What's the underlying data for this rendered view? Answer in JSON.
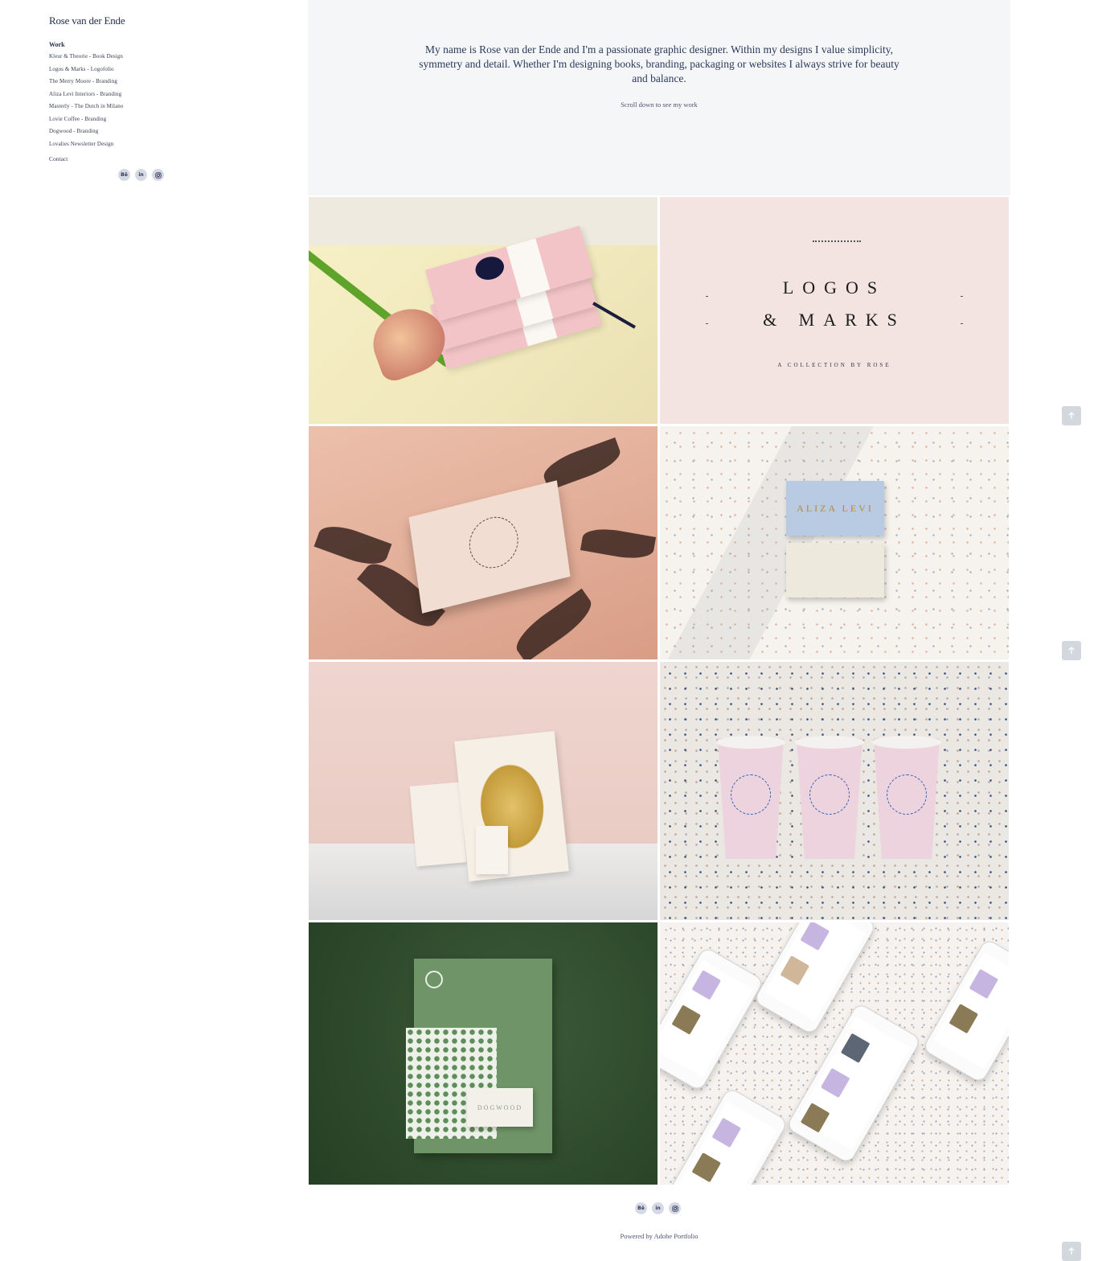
{
  "site": {
    "title": "Rose van der Ende"
  },
  "nav": {
    "section": "Work",
    "items": [
      "Kleur & Theorie - Book Design",
      "Logos & Marks - Logofolio",
      "The Merry Moore - Branding",
      "Aliza Levi Interiors - Branding",
      "Masterly - The Dutch in Milano",
      "Lovie Coffee - Branding",
      "Dogwood - Branding",
      "Lovalies Newsletter Design"
    ],
    "contact": "Contact"
  },
  "social": {
    "behance": "Bē",
    "linkedin": "in",
    "instagram": "instagram-icon"
  },
  "intro": {
    "text": "My name is Rose van der Ende and I'm a passionate graphic designer. Within my designs I value simplicity, symmetry and detail. Whether I'm designing books, branding, packaging or websites I always strive for beauty and balance.",
    "scroll_hint": "Scroll down to see my work"
  },
  "tiles": {
    "logos": {
      "line1": "LOGOS",
      "line2": "& MARKS",
      "sub": "A COLLECTION BY ROSE"
    },
    "aliza": {
      "brand": "ALIZA LEVI"
    },
    "dogwood": {
      "brand": "DOGWOOD"
    }
  },
  "footer": {
    "powered": "Powered by Adobe Portfolio"
  },
  "colors": {
    "accent": "#24304d",
    "intro_bg": "#f5f6f7",
    "social_bg": "#d6d9e4"
  }
}
